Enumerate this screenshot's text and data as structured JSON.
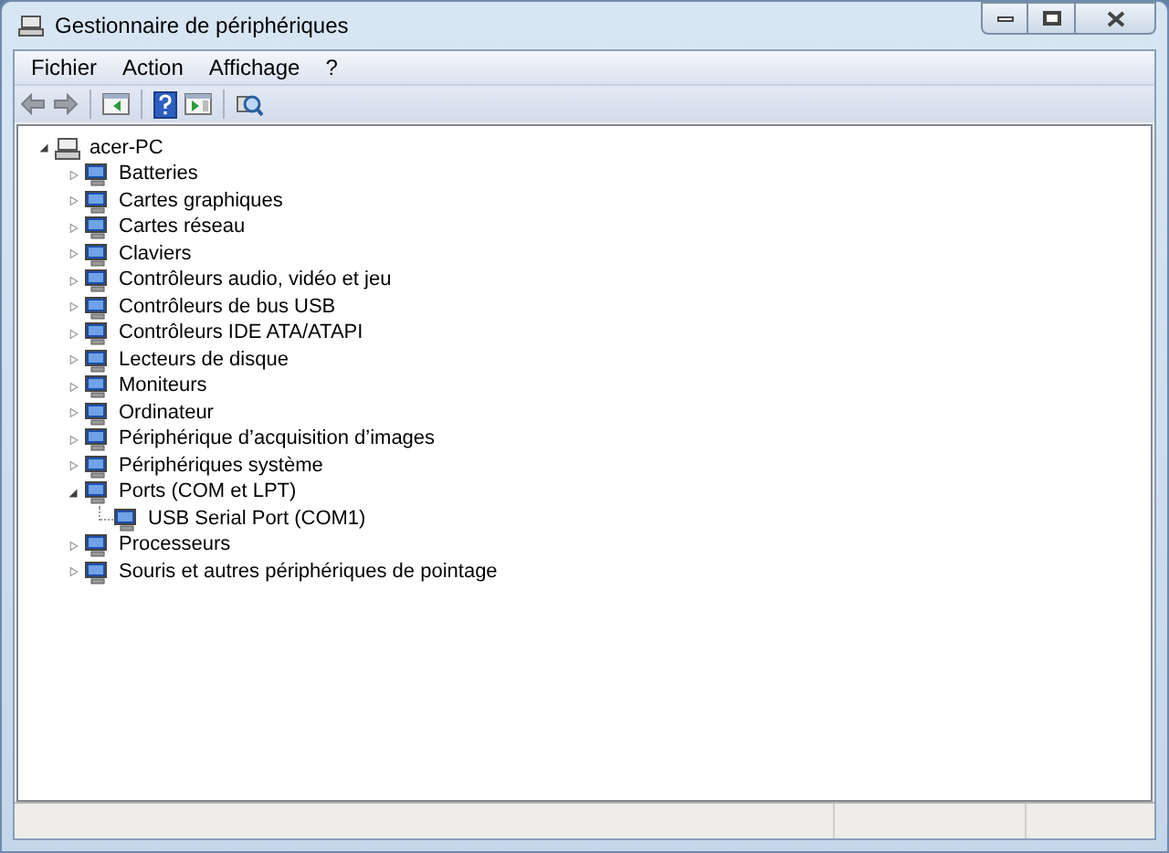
{
  "window": {
    "title": "Gestionnaire de périphériques"
  },
  "menu": [
    "Fichier",
    "Action",
    "Affichage",
    "?"
  ],
  "tree": {
    "label": "acer-PC",
    "expanded": true,
    "children": [
      {
        "label": "Batteries",
        "expanded": false
      },
      {
        "label": "Cartes graphiques",
        "expanded": false
      },
      {
        "label": "Cartes réseau",
        "expanded": false
      },
      {
        "label": "Claviers",
        "expanded": false
      },
      {
        "label": "Contrôleurs audio, vidéo et jeu",
        "expanded": false
      },
      {
        "label": "Contrôleurs de bus USB",
        "expanded": false
      },
      {
        "label": "Contrôleurs IDE ATA/ATAPI",
        "expanded": false
      },
      {
        "label": "Lecteurs de disque",
        "expanded": false
      },
      {
        "label": "Moniteurs",
        "expanded": false
      },
      {
        "label": "Ordinateur",
        "expanded": false
      },
      {
        "label": "Périphérique d’acquisition d’images",
        "expanded": false
      },
      {
        "label": "Périphériques système",
        "expanded": false
      },
      {
        "label": "Ports (COM et LPT)",
        "expanded": true,
        "children": [
          {
            "label": "USB Serial Port (COM1)"
          }
        ]
      },
      {
        "label": "Processeurs",
        "expanded": false
      },
      {
        "label": "Souris et autres périphériques de pointage",
        "expanded": false
      }
    ]
  }
}
